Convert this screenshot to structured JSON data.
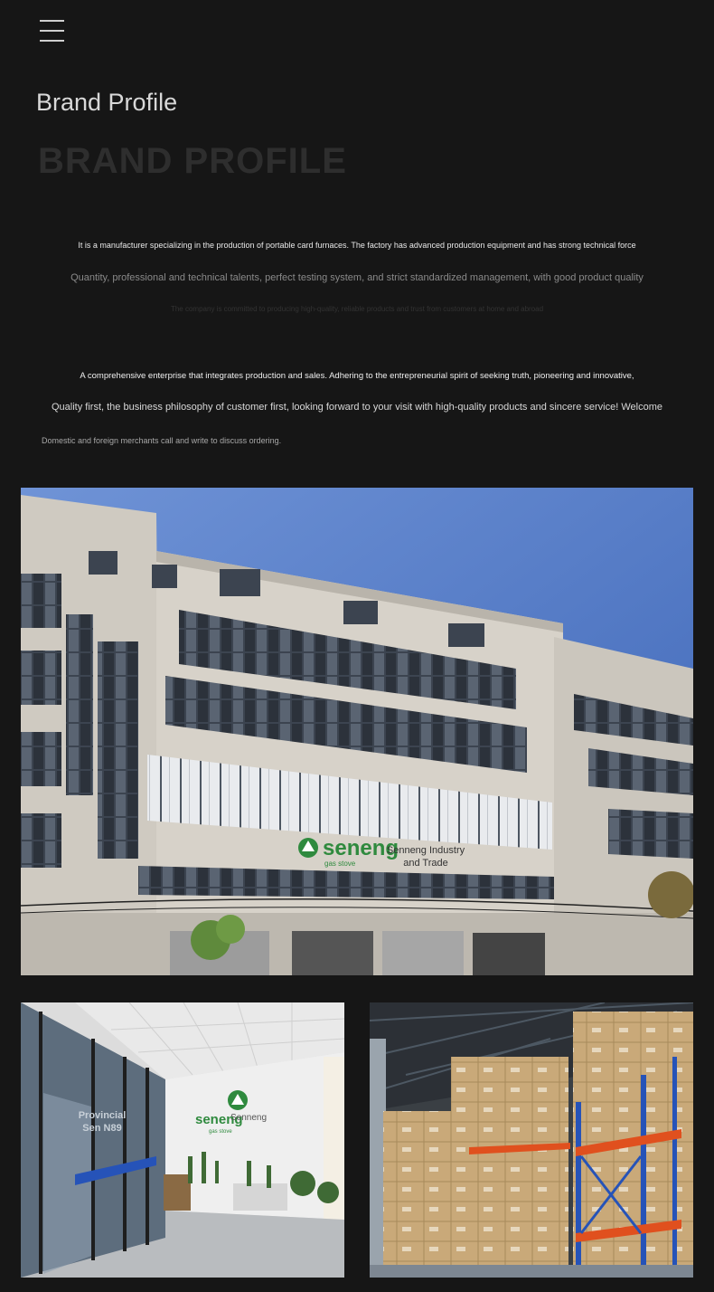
{
  "nav": {
    "menu_icon": "hamburger-menu-icon"
  },
  "header": {
    "title": "Brand Profile",
    "background_title": "BRAND PROFILE"
  },
  "intro": {
    "line1": "It is a manufacturer specializing in the production of portable card furnaces. The factory has advanced production equipment and has strong technical force",
    "line2": "Quantity, professional and technical talents, perfect testing system, and strict standardized management, with good product quality",
    "line3": "The company is committed to producing high-quality, reliable products and trust from customers at home and abroad",
    "line4": "A comprehensive enterprise that integrates production and sales. Adhering to the entrepreneurial spirit of seeking truth, pioneering and innovative,",
    "line5": "Quality first, the business philosophy of customer first, looking forward to your visit with high-quality products and sincere service! Welcome",
    "line6": "Domestic and foreign merchants call and write to discuss ordering."
  },
  "images": {
    "building": {
      "sign_brand": "seneng",
      "sign_sub": "gas stove",
      "sign_caption_1": "Senneng Industry",
      "sign_caption_2": "and Trade"
    },
    "office": {
      "logo_brand": "seneng",
      "logo_sub": "gas stove",
      "logo_caption": "Senneng",
      "glass_text_1": "Provincial",
      "glass_text_2": "Sen N89"
    }
  },
  "colors": {
    "background": "#161616",
    "sky": "#4f78c4",
    "building": "#d3cec5",
    "brand_green": "#2f8a3e",
    "rack_blue": "#2653b8",
    "rack_orange": "#e0501e",
    "box": "#c9a979"
  }
}
